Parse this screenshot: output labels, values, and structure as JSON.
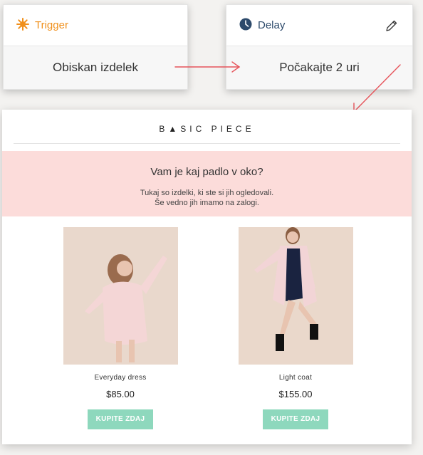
{
  "trigger": {
    "label": "Trigger",
    "text": "Obiskan izdelek",
    "icon": "sun-icon",
    "color": "#f0901c"
  },
  "delay": {
    "label": "Delay",
    "text": "Počakajte 2 uri",
    "icon": "clock-icon",
    "edit_icon": "pencil-icon"
  },
  "email": {
    "logo": "B▲SIC  PIECE",
    "headline": "Vam je kaj padlo v oko?",
    "subtext_line1": "Tukaj so izdelki, ki ste si jih ogledovali.",
    "subtext_line2": "Še vedno jih imamo na zalogi.",
    "banner_color": "#fcdcda",
    "products": [
      {
        "name": "Everyday dress",
        "price": "$85.00",
        "button": "KUPITE ZDAJ"
      },
      {
        "name": "Light coat",
        "price": "$155.00",
        "button": "KUPITE ZDAJ"
      }
    ],
    "button_color": "#8ed8bd"
  },
  "arrow_color": "#e6535a"
}
